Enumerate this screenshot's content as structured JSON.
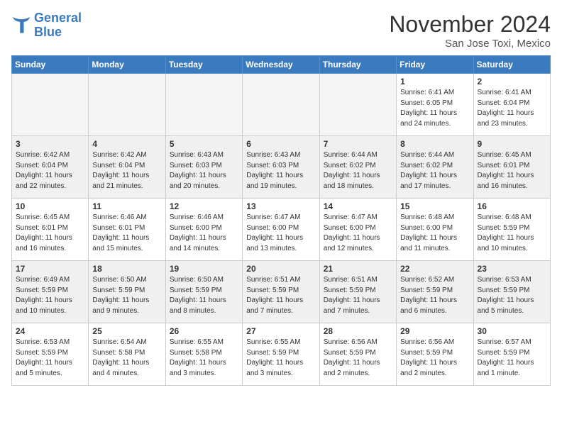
{
  "logo": {
    "line1": "General",
    "line2": "Blue"
  },
  "title": "November 2024",
  "location": "San Jose Toxi, Mexico",
  "days_of_week": [
    "Sunday",
    "Monday",
    "Tuesday",
    "Wednesday",
    "Thursday",
    "Friday",
    "Saturday"
  ],
  "weeks": [
    [
      {
        "day": "",
        "info": "",
        "empty": true
      },
      {
        "day": "",
        "info": "",
        "empty": true
      },
      {
        "day": "",
        "info": "",
        "empty": true
      },
      {
        "day": "",
        "info": "",
        "empty": true
      },
      {
        "day": "",
        "info": "",
        "empty": true
      },
      {
        "day": "1",
        "info": "Sunrise: 6:41 AM\nSunset: 6:05 PM\nDaylight: 11 hours\nand 24 minutes.",
        "empty": false
      },
      {
        "day": "2",
        "info": "Sunrise: 6:41 AM\nSunset: 6:04 PM\nDaylight: 11 hours\nand 23 minutes.",
        "empty": false
      }
    ],
    [
      {
        "day": "3",
        "info": "Sunrise: 6:42 AM\nSunset: 6:04 PM\nDaylight: 11 hours\nand 22 minutes.",
        "empty": false
      },
      {
        "day": "4",
        "info": "Sunrise: 6:42 AM\nSunset: 6:04 PM\nDaylight: 11 hours\nand 21 minutes.",
        "empty": false
      },
      {
        "day": "5",
        "info": "Sunrise: 6:43 AM\nSunset: 6:03 PM\nDaylight: 11 hours\nand 20 minutes.",
        "empty": false
      },
      {
        "day": "6",
        "info": "Sunrise: 6:43 AM\nSunset: 6:03 PM\nDaylight: 11 hours\nand 19 minutes.",
        "empty": false
      },
      {
        "day": "7",
        "info": "Sunrise: 6:44 AM\nSunset: 6:02 PM\nDaylight: 11 hours\nand 18 minutes.",
        "empty": false
      },
      {
        "day": "8",
        "info": "Sunrise: 6:44 AM\nSunset: 6:02 PM\nDaylight: 11 hours\nand 17 minutes.",
        "empty": false
      },
      {
        "day": "9",
        "info": "Sunrise: 6:45 AM\nSunset: 6:01 PM\nDaylight: 11 hours\nand 16 minutes.",
        "empty": false
      }
    ],
    [
      {
        "day": "10",
        "info": "Sunrise: 6:45 AM\nSunset: 6:01 PM\nDaylight: 11 hours\nand 16 minutes.",
        "empty": false
      },
      {
        "day": "11",
        "info": "Sunrise: 6:46 AM\nSunset: 6:01 PM\nDaylight: 11 hours\nand 15 minutes.",
        "empty": false
      },
      {
        "day": "12",
        "info": "Sunrise: 6:46 AM\nSunset: 6:00 PM\nDaylight: 11 hours\nand 14 minutes.",
        "empty": false
      },
      {
        "day": "13",
        "info": "Sunrise: 6:47 AM\nSunset: 6:00 PM\nDaylight: 11 hours\nand 13 minutes.",
        "empty": false
      },
      {
        "day": "14",
        "info": "Sunrise: 6:47 AM\nSunset: 6:00 PM\nDaylight: 11 hours\nand 12 minutes.",
        "empty": false
      },
      {
        "day": "15",
        "info": "Sunrise: 6:48 AM\nSunset: 6:00 PM\nDaylight: 11 hours\nand 11 minutes.",
        "empty": false
      },
      {
        "day": "16",
        "info": "Sunrise: 6:48 AM\nSunset: 5:59 PM\nDaylight: 11 hours\nand 10 minutes.",
        "empty": false
      }
    ],
    [
      {
        "day": "17",
        "info": "Sunrise: 6:49 AM\nSunset: 5:59 PM\nDaylight: 11 hours\nand 10 minutes.",
        "empty": false
      },
      {
        "day": "18",
        "info": "Sunrise: 6:50 AM\nSunset: 5:59 PM\nDaylight: 11 hours\nand 9 minutes.",
        "empty": false
      },
      {
        "day": "19",
        "info": "Sunrise: 6:50 AM\nSunset: 5:59 PM\nDaylight: 11 hours\nand 8 minutes.",
        "empty": false
      },
      {
        "day": "20",
        "info": "Sunrise: 6:51 AM\nSunset: 5:59 PM\nDaylight: 11 hours\nand 7 minutes.",
        "empty": false
      },
      {
        "day": "21",
        "info": "Sunrise: 6:51 AM\nSunset: 5:59 PM\nDaylight: 11 hours\nand 7 minutes.",
        "empty": false
      },
      {
        "day": "22",
        "info": "Sunrise: 6:52 AM\nSunset: 5:59 PM\nDaylight: 11 hours\nand 6 minutes.",
        "empty": false
      },
      {
        "day": "23",
        "info": "Sunrise: 6:53 AM\nSunset: 5:59 PM\nDaylight: 11 hours\nand 5 minutes.",
        "empty": false
      }
    ],
    [
      {
        "day": "24",
        "info": "Sunrise: 6:53 AM\nSunset: 5:59 PM\nDaylight: 11 hours\nand 5 minutes.",
        "empty": false
      },
      {
        "day": "25",
        "info": "Sunrise: 6:54 AM\nSunset: 5:58 PM\nDaylight: 11 hours\nand 4 minutes.",
        "empty": false
      },
      {
        "day": "26",
        "info": "Sunrise: 6:55 AM\nSunset: 5:58 PM\nDaylight: 11 hours\nand 3 minutes.",
        "empty": false
      },
      {
        "day": "27",
        "info": "Sunrise: 6:55 AM\nSunset: 5:59 PM\nDaylight: 11 hours\nand 3 minutes.",
        "empty": false
      },
      {
        "day": "28",
        "info": "Sunrise: 6:56 AM\nSunset: 5:59 PM\nDaylight: 11 hours\nand 2 minutes.",
        "empty": false
      },
      {
        "day": "29",
        "info": "Sunrise: 6:56 AM\nSunset: 5:59 PM\nDaylight: 11 hours\nand 2 minutes.",
        "empty": false
      },
      {
        "day": "30",
        "info": "Sunrise: 6:57 AM\nSunset: 5:59 PM\nDaylight: 11 hours\nand 1 minute.",
        "empty": false
      }
    ]
  ]
}
